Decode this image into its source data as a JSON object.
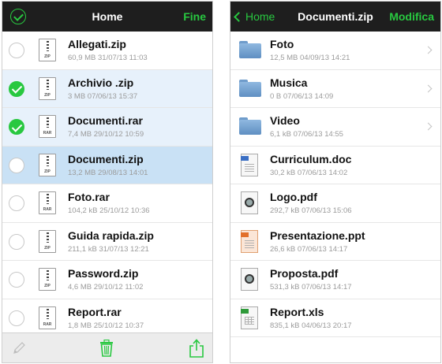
{
  "colors": {
    "accent": "#28c840",
    "navbar": "#1e1e1e",
    "selected_row": "#e7f1fb",
    "active_row": "#c9e1f5"
  },
  "left": {
    "nav": {
      "title": "Home",
      "right_button": "Fine",
      "left_icon": "checkmark-circle-icon"
    },
    "files": [
      {
        "name": "Allegati.zip",
        "meta": "60,9 MB 31/07/13 11:03",
        "ext": "ZIP",
        "checked": false
      },
      {
        "name": "Archivio .zip",
        "meta": "3 MB 07/06/13 15:37",
        "ext": "ZIP",
        "checked": true
      },
      {
        "name": "Documenti.rar",
        "meta": "7,4 MB 29/10/12 10:59",
        "ext": "RAR",
        "checked": true
      },
      {
        "name": "Documenti.zip",
        "meta": "13,2 MB 29/08/13 14:01",
        "ext": "ZIP",
        "checked": false
      },
      {
        "name": "Foto.rar",
        "meta": "104,2 kB 25/10/12 10:36",
        "ext": "RAR",
        "checked": false
      },
      {
        "name": "Guida rapida.zip",
        "meta": "211,1 kB 31/07/13 12:21",
        "ext": "ZIP",
        "checked": false
      },
      {
        "name": "Password.zip",
        "meta": "4,6 MB 29/10/12 11:02",
        "ext": "ZIP",
        "checked": false
      },
      {
        "name": "Report.rar",
        "meta": "1,8 MB 25/10/12 10:37",
        "ext": "RAR",
        "checked": false
      }
    ],
    "toolbar": [
      "pencil-icon",
      "trash-icon",
      "share-icon"
    ]
  },
  "right": {
    "nav": {
      "back_label": "Home",
      "title": "Documenti.zip",
      "right_button": "Modifica"
    },
    "items": [
      {
        "name": "Foto",
        "meta": "12,5 MB 04/09/13 14:21",
        "kind": "folder"
      },
      {
        "name": "Musica",
        "meta": "0 B 07/06/13 14:09",
        "kind": "folder"
      },
      {
        "name": "Video",
        "meta": "6,1 kB 07/06/13 14:55",
        "kind": "folder"
      },
      {
        "name": "Curriculum.doc",
        "meta": "30,2 kB 07/06/13 14:02",
        "kind": "doc"
      },
      {
        "name": "Logo.pdf",
        "meta": "292,7 kB 07/06/13 15:06",
        "kind": "pdf"
      },
      {
        "name": "Presentazione.ppt",
        "meta": "26,6 kB 07/06/13 14:17",
        "kind": "ppt"
      },
      {
        "name": "Proposta.pdf",
        "meta": "531,3 kB 07/06/13 14:17",
        "kind": "pdf"
      },
      {
        "name": "Report.xls",
        "meta": "835,1 kB 04/06/13 20:17",
        "kind": "xls"
      }
    ]
  }
}
